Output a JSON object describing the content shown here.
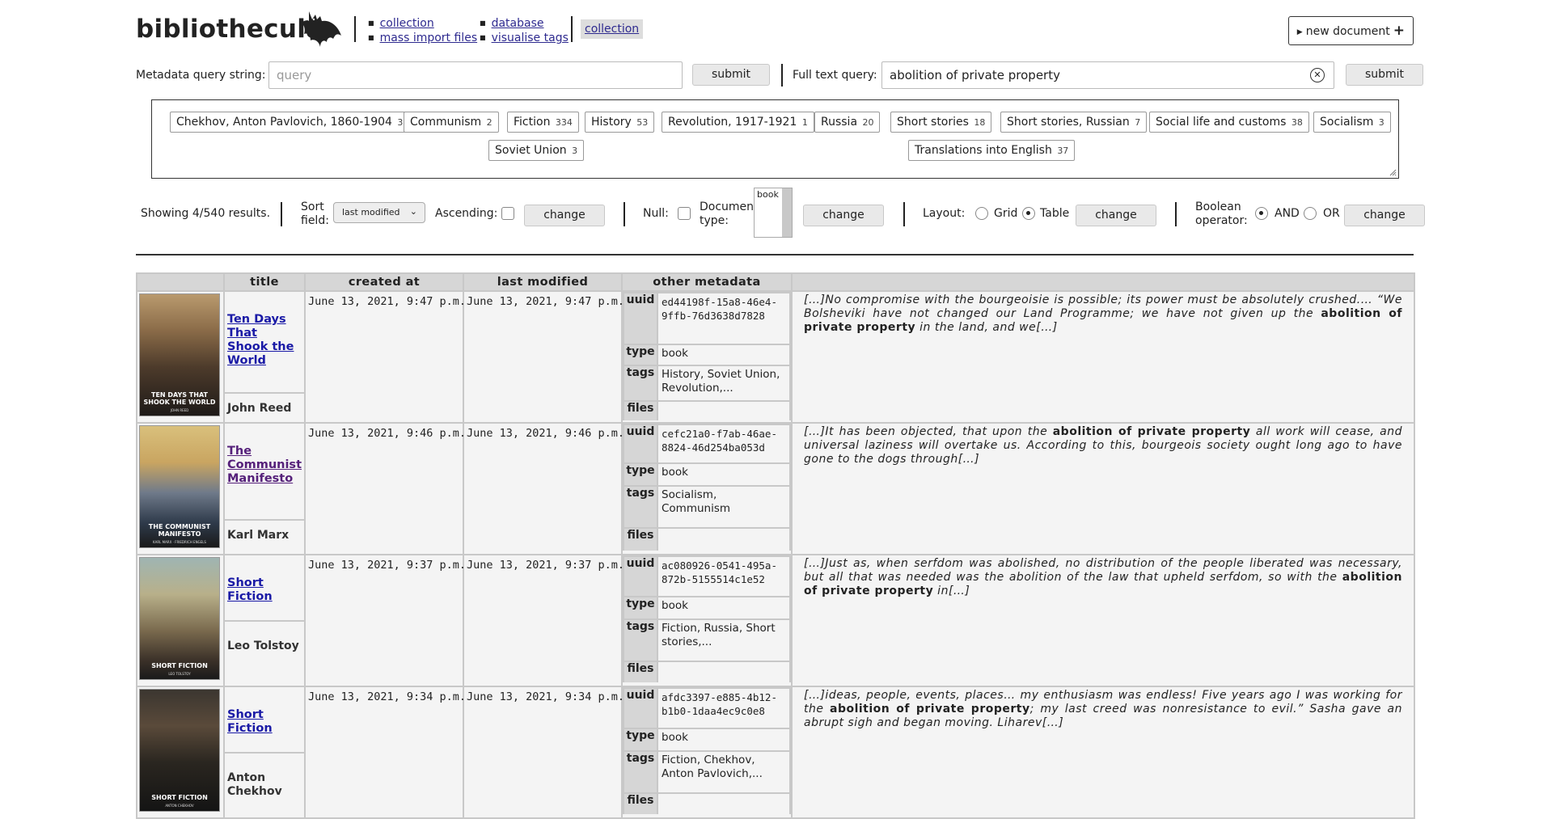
{
  "header": {
    "brand": "bibliothecula",
    "nav_left": [
      "collection",
      "mass import files"
    ],
    "nav_right": [
      "database",
      "visualise tags"
    ],
    "nav_current": "collection",
    "new_document": "new document"
  },
  "query": {
    "metadata_label": "Metadata query string:",
    "metadata_placeholder": "query",
    "metadata_submit": "submit",
    "fulltext_label": "Full text query:",
    "fulltext_value": "abolition of private property",
    "fulltext_submit": "submit"
  },
  "tags": [
    {
      "name": "Chekhov, Anton Pavlovich, 1860-1904",
      "count": "3"
    },
    {
      "name": "Communism",
      "count": "2"
    },
    {
      "name": "Fiction",
      "count": "334"
    },
    {
      "name": "History",
      "count": "53"
    },
    {
      "name": "Revolution, 1917-1921",
      "count": "1"
    },
    {
      "name": "Russia",
      "count": "20"
    },
    {
      "name": "Short stories",
      "count": "18"
    },
    {
      "name": "Short stories, Russian",
      "count": "7"
    },
    {
      "name": "Social life and customs",
      "count": "38"
    },
    {
      "name": "Socialism",
      "count": "3"
    },
    {
      "name": "Soviet Union",
      "count": "3"
    },
    {
      "name": "Translations into English",
      "count": "37"
    }
  ],
  "controls": {
    "showing": "Showing 4/540 results.",
    "sort_field_label": "Sort field:",
    "sort_field_value": "last modified",
    "ascending_label": "Ascending:",
    "change": "change",
    "null_label": "Null:",
    "doc_type_label": "Document type:",
    "doc_type_option": "book",
    "layout_label": "Layout:",
    "layout_grid": "Grid",
    "layout_table": "Table",
    "boolean_label": "Boolean operator:",
    "bool_and": "AND",
    "bool_or": "OR"
  },
  "table": {
    "headers": [
      "",
      "title",
      "created at",
      "last modified",
      "other metadata",
      ""
    ],
    "meta_keys": {
      "uuid": "uuid",
      "type": "type",
      "tags": "tags",
      "files": "files"
    },
    "rows": [
      {
        "title": "Ten Days That Shook the World",
        "author": "John Reed",
        "cover_title": "TEN DAYS THAT SHOOK THE WORLD",
        "cover_author": "JOHN REED",
        "created": "June 13, 2021, 9:47 p.m.",
        "modified": "June 13, 2021, 9:47 p.m.",
        "uuid": "ed44198f-15a8-46e4-9ffb-76d3638d7828",
        "type": "book",
        "tags": "History, Soviet Union, Revolution,...",
        "files": "",
        "snip_pre": "[…]No compromise with the bourgeoisie is possible; its power must be absolutely crushed.… “We Bolsheviki have not changed our Land Programme; we have not given up the ",
        "snip_hl": "abolition of private property",
        "snip_post": " in the land, and we[…]"
      },
      {
        "title": "The Communist Manifesto",
        "author": "Karl Marx",
        "cover_title": "THE COMMUNIST MANIFESTO",
        "cover_author": "KARL MARX · FRIEDRICH ENGELS",
        "created": "June 13, 2021, 9:46 p.m.",
        "modified": "June 13, 2021, 9:46 p.m.",
        "uuid": "cefc21a0-f7ab-46ae-8824-46d254ba053d",
        "type": "book",
        "tags": "Socialism, Communism",
        "files": "",
        "snip_pre": "[…]It has been objected, that upon the ",
        "snip_hl": "abolition of private property",
        "snip_post": " all work will cease, and universal laziness will overtake us. According to this, bourgeois society ought long ago to have gone to the dogs through[…]"
      },
      {
        "title": "Short Fiction",
        "author": "Leo Tolstoy",
        "cover_title": "SHORT FICTION",
        "cover_author": "LEO TOLSTOY",
        "created": "June 13, 2021, 9:37 p.m.",
        "modified": "June 13, 2021, 9:37 p.m.",
        "uuid": "ac080926-0541-495a-872b-5155514c1e52",
        "type": "book",
        "tags": "Fiction, Russia, Short stories,...",
        "files": "",
        "snip_pre": "[…]Just as, when serfdom was abolished, no distribution of the people liberated was necessary, but all that was needed was the abolition of the law that upheld serfdom, so with the ",
        "snip_hl": "abolition of private property",
        "snip_post": " in[…]"
      },
      {
        "title": "Short Fiction",
        "author": "Anton Chekhov",
        "cover_title": "SHORT FICTION",
        "cover_author": "ANTON CHEKHOV",
        "created": "June 13, 2021, 9:34 p.m.",
        "modified": "June 13, 2021, 9:34 p.m.",
        "uuid": "afdc3397-e885-4b12-b1b0-1daa4ec9c0e8",
        "type": "book",
        "tags": "Fiction, Chekhov, Anton Pavlovich,...",
        "files": "",
        "snip_pre": "[…]ideas, people, events, places… my enthusiasm was endless! Five years ago I was working for the ",
        "snip_hl": "abolition of private property",
        "snip_post": "; my last creed was nonresistance to evil.” Sasha gave an abrupt sigh and began moving. Liharev[…]"
      }
    ]
  }
}
